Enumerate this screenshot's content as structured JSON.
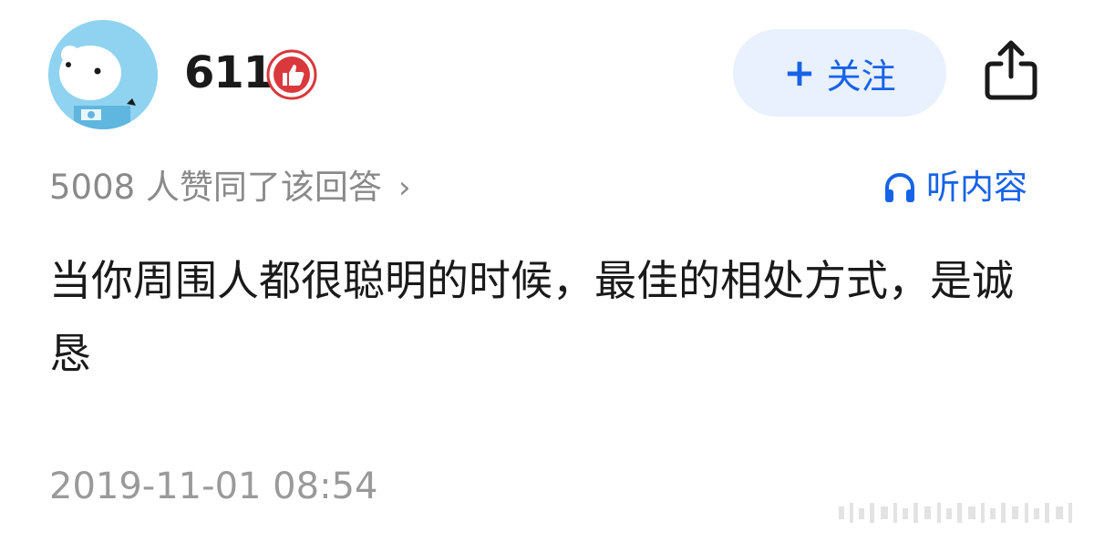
{
  "author": {
    "name": "611",
    "avatar_icon": "cartoon-bear-avatar",
    "badge_icon": "thumbs-up-badge-icon"
  },
  "actions": {
    "follow_plus": "+",
    "follow_label": "关注",
    "share_icon": "share-icon"
  },
  "stats": {
    "upvote_text": "5008 人赞同了该回答",
    "chevron": "›"
  },
  "listen": {
    "icon": "headphones-icon",
    "label": "听内容"
  },
  "answer": {
    "text": "当你周围人都很聪明的时候，最佳的相处方式，是诚恳"
  },
  "meta": {
    "timestamp": "2019-11-01 08:54"
  },
  "colors": {
    "accent": "#1763e8",
    "follow_bg": "#e9f0fe",
    "muted": "#8a8a8a",
    "badge_red": "#d9383c"
  }
}
